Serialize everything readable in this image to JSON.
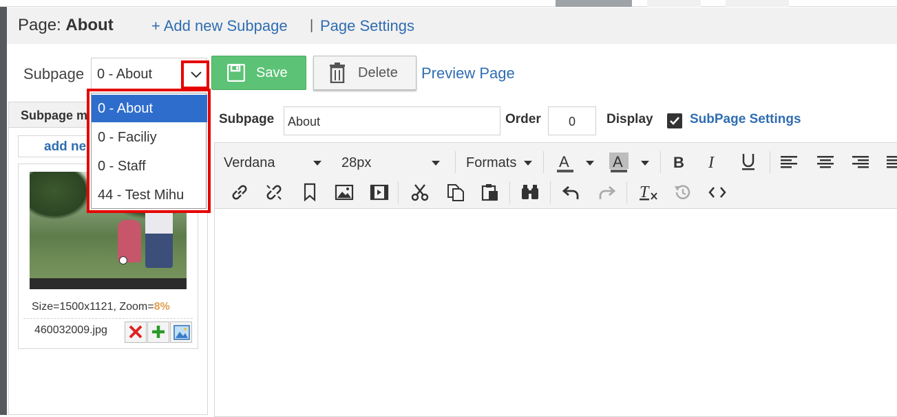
{
  "header": {
    "page_prefix": "Page: ",
    "page_name": "About",
    "add_subpage_link": "+ Add new Subpage",
    "separator": "|",
    "page_settings_link": "Page Settings"
  },
  "toolbar_top": {
    "subpage_label": "Subpage",
    "selected_subpage": "0 - About",
    "save_label": "Save",
    "delete_label": "Delete",
    "preview_label": "Preview Page"
  },
  "dropdown": {
    "options": [
      "0 - About",
      "0 - Faciliy",
      "0 - Staff",
      "44 - Test Mihu"
    ]
  },
  "left_panel": {
    "header": "Subpage m",
    "add_new": "add ne",
    "image_size": "Size=1500x1121, Zoom=",
    "zoom": "8%",
    "filename": "460032009.jpg"
  },
  "form": {
    "subpage_label": "Subpage",
    "subpage_value": "About",
    "order_label": "Order",
    "order_value": "0",
    "display_label": "Display",
    "display_checked": true,
    "subpage_settings_link": "SubPage Settings"
  },
  "editor": {
    "font_family": "Verdana",
    "font_size": "28px",
    "formats_label": "Formats"
  },
  "colors": {
    "accent": "#2f6db0",
    "save_green": "#5cc275",
    "highlight_red": "#e60000",
    "selected_blue": "#2f6dcc"
  }
}
